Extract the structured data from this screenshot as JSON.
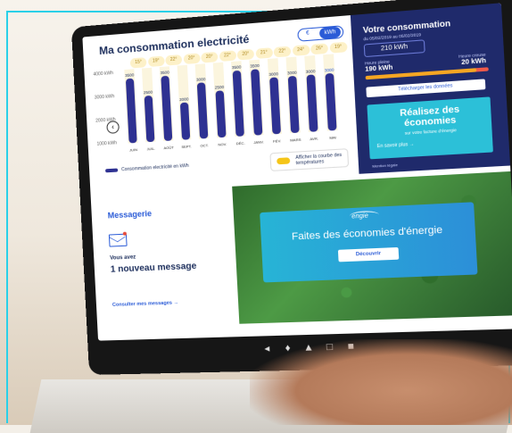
{
  "chart": {
    "title": "Ma consommation electricité",
    "unit_euro": "€",
    "unit_kwh": "kWh",
    "y_ticks": [
      "4000 kWh",
      "3000 kWh",
      "2000 kWh",
      "1000 kWh"
    ],
    "temperatures": [
      "15°",
      "19°",
      "22°",
      "20°",
      "20°",
      "22°",
      "20°",
      "21°",
      "22°",
      "24°",
      "26°",
      "19°"
    ],
    "legend": "Consommation electricité en kWh",
    "temp_toggle_label": "Afficher la courbe des températures",
    "prev_arrow": "‹"
  },
  "chart_data": {
    "type": "bar",
    "categories": [
      "JUIN",
      "JUIL.",
      "AOÛT",
      "SEPT.",
      "OCT.",
      "NOV.",
      "DÉC.",
      "JANV.",
      "FÉV.",
      "MARS",
      "AVR.",
      "MAI"
    ],
    "values": [
      3500,
      2500,
      3500,
      2000,
      3000,
      2500,
      3500,
      3500,
      3000,
      3000,
      3000,
      3000
    ],
    "ylim": [
      0,
      4000
    ]
  },
  "conso": {
    "title": "Votre consommation",
    "dates": "du 05/02/2019 au 05/02/2019",
    "total": "210 kWh",
    "hp_label": "Heure pleine",
    "hp_value": "190 kWh",
    "hc_label": "Heure creuse",
    "hc_value": "20 kWh",
    "hp_fraction": 0.9,
    "download": "Télécharger les données",
    "promo_title": "Réalisez des économies",
    "promo_sub": "sur votre facture d'énergie",
    "promo_link": "En savoir plus →",
    "footer": "Mention légale"
  },
  "messages": {
    "title": "Messagerie",
    "sub": "Vous avez",
    "main": "1 nouveau message",
    "link": "Consulter mes messages →"
  },
  "engie": {
    "logo": "engie",
    "title": "Faites des économies d'énergie",
    "button": "Découvrir"
  },
  "colors": {
    "bar": "#2e3192",
    "accent": "#2a5bd7",
    "navy": "#1f2a6b",
    "cyan": "#2cc0d8",
    "frame": "#2ad0e8"
  }
}
